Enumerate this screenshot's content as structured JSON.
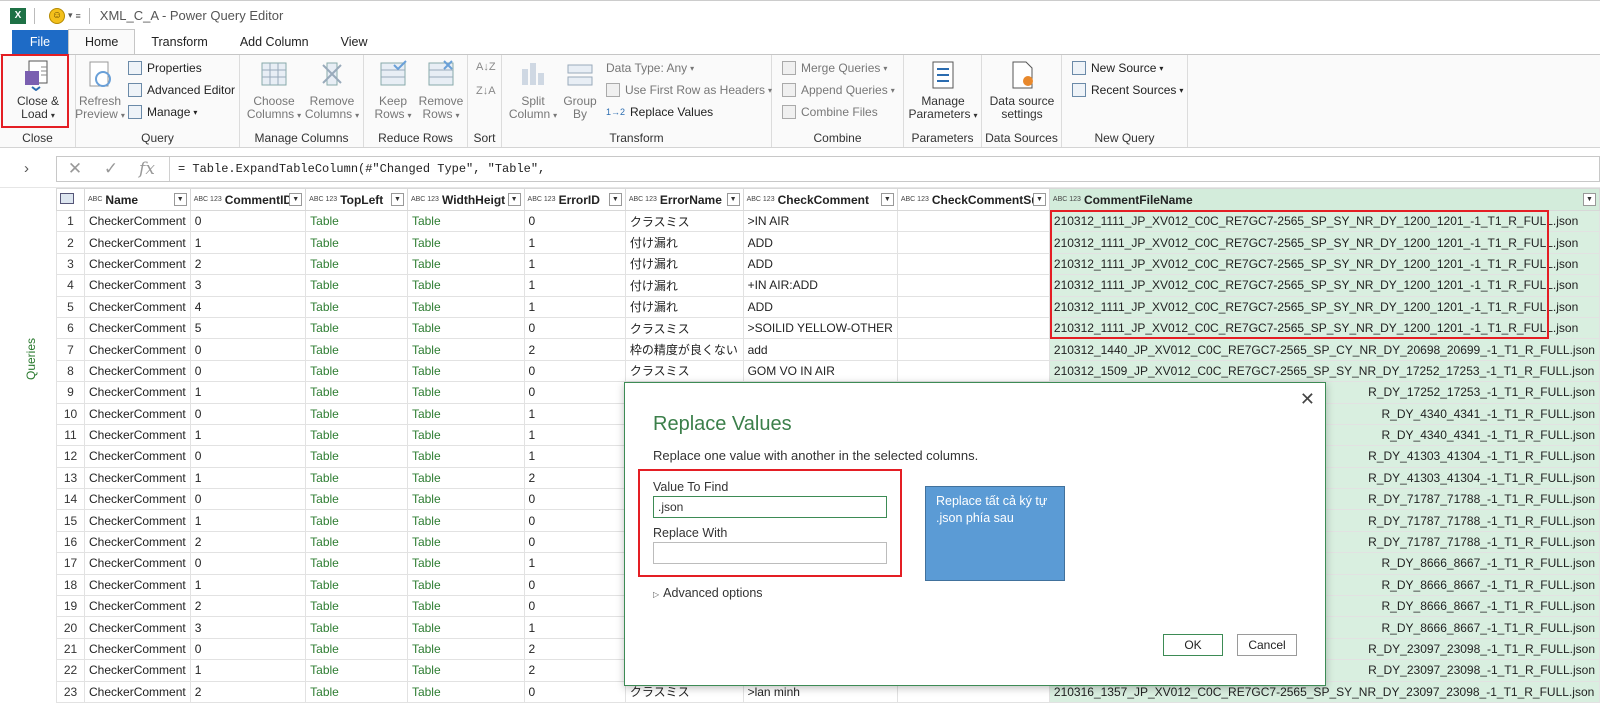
{
  "titlebar": {
    "app_icon": "X",
    "title": "XML_C_A - Power Query Editor"
  },
  "tabs": [
    "File",
    "Home",
    "Transform",
    "Add Column",
    "View"
  ],
  "ribbon": {
    "close": {
      "button": [
        "Close &",
        "Load"
      ],
      "label": "Close"
    },
    "query": {
      "refresh": [
        "Refresh",
        "Preview"
      ],
      "properties": "Properties",
      "advanced_editor": "Advanced Editor",
      "manage": "Manage",
      "label": "Query"
    },
    "manage_columns": {
      "choose": [
        "Choose",
        "Columns"
      ],
      "remove": [
        "Remove",
        "Columns"
      ],
      "label": "Manage Columns"
    },
    "reduce_rows": {
      "keep": [
        "Keep",
        "Rows"
      ],
      "remove": [
        "Remove",
        "Rows"
      ],
      "label": "Reduce Rows"
    },
    "sort": {
      "label": "Sort"
    },
    "transform": {
      "split": [
        "Split",
        "Column"
      ],
      "group": [
        "Group",
        "By"
      ],
      "data_type": "Data Type: Any",
      "first_row": "Use First Row as Headers",
      "replace": "Replace Values",
      "label": "Transform"
    },
    "combine": {
      "merge": "Merge Queries",
      "append": "Append Queries",
      "combine_files": "Combine Files",
      "label": "Combine"
    },
    "parameters": {
      "manage": [
        "Manage",
        "Parameters"
      ],
      "label": "Parameters"
    },
    "data_sources": {
      "settings": [
        "Data source",
        "settings"
      ],
      "label": "Data Sources"
    },
    "new_query": {
      "new_source": "New Source",
      "recent_sources": "Recent Sources",
      "label": "New Query"
    }
  },
  "formula": {
    "text": "= Table.ExpandTableColumn(#\"Changed Type\", \"Table\","
  },
  "queries_label": "Queries",
  "columns": [
    {
      "type": "ABC",
      "name": "Name"
    },
    {
      "type": "ABC 123",
      "name": "CommentID"
    },
    {
      "type": "ABC 123",
      "name": "TopLeft"
    },
    {
      "type": "ABC 123",
      "name": "WidthHeigt"
    },
    {
      "type": "ABC 123",
      "name": "ErrorID"
    },
    {
      "type": "ABC 123",
      "name": "ErrorName"
    },
    {
      "type": "ABC 123",
      "name": "CheckComment"
    },
    {
      "type": "ABC 123",
      "name": "CheckCommentSub"
    },
    {
      "type": "ABC 123",
      "name": "CommentFileName"
    }
  ],
  "rows": [
    [
      "1",
      "CheckerComment",
      "0",
      "Table",
      "Table",
      "0",
      "クラスミス",
      ">IN AIR",
      "",
      "210312_1111_JP_XV012_C0C_RE7GC7-2565_SP_SY_NR_DY_1200_1201_-1_T1_R_FULL.json"
    ],
    [
      "2",
      "CheckerComment",
      "1",
      "Table",
      "Table",
      "1",
      "付け漏れ",
      "ADD",
      "",
      "210312_1111_JP_XV012_C0C_RE7GC7-2565_SP_SY_NR_DY_1200_1201_-1_T1_R_FULL.json"
    ],
    [
      "3",
      "CheckerComment",
      "2",
      "Table",
      "Table",
      "1",
      "付け漏れ",
      "ADD",
      "",
      "210312_1111_JP_XV012_C0C_RE7GC7-2565_SP_SY_NR_DY_1200_1201_-1_T1_R_FULL.json"
    ],
    [
      "4",
      "CheckerComment",
      "3",
      "Table",
      "Table",
      "1",
      "付け漏れ",
      "+IN AIR:ADD",
      "",
      "210312_1111_JP_XV012_C0C_RE7GC7-2565_SP_SY_NR_DY_1200_1201_-1_T1_R_FULL.json"
    ],
    [
      "5",
      "CheckerComment",
      "4",
      "Table",
      "Table",
      "1",
      "付け漏れ",
      "ADD",
      "",
      "210312_1111_JP_XV012_C0C_RE7GC7-2565_SP_SY_NR_DY_1200_1201_-1_T1_R_FULL.json"
    ],
    [
      "6",
      "CheckerComment",
      "5",
      "Table",
      "Table",
      "0",
      "クラスミス",
      ">SOILID YELLOW-OTHER",
      "",
      "210312_1111_JP_XV012_C0C_RE7GC7-2565_SP_SY_NR_DY_1200_1201_-1_T1_R_FULL.json"
    ],
    [
      "7",
      "CheckerComment",
      "0",
      "Table",
      "Table",
      "2",
      "枠の精度が良くない",
      "add",
      "",
      "210312_1440_JP_XV012_C0C_RE7GC7-2565_SP_CY_NR_DY_20698_20699_-1_T1_R_FULL.json"
    ],
    [
      "8",
      "CheckerComment",
      "0",
      "Table",
      "Table",
      "0",
      "クラスミス",
      "GOM VO IN AIR",
      "",
      "210312_1509_JP_XV012_C0C_RE7GC7-2565_SP_SY_NR_DY_17252_17253_-1_T1_R_FULL.json"
    ],
    [
      "9",
      "CheckerComment",
      "1",
      "Table",
      "Table",
      "0",
      "",
      "",
      "",
      "R_DY_17252_17253_-1_T1_R_FULL.json"
    ],
    [
      "10",
      "CheckerComment",
      "0",
      "Table",
      "Table",
      "1",
      "",
      "",
      "",
      "R_DY_4340_4341_-1_T1_R_FULL.json"
    ],
    [
      "11",
      "CheckerComment",
      "1",
      "Table",
      "Table",
      "1",
      "",
      "",
      "",
      "R_DY_4340_4341_-1_T1_R_FULL.json"
    ],
    [
      "12",
      "CheckerComment",
      "0",
      "Table",
      "Table",
      "1",
      "",
      "",
      "",
      "R_DY_41303_41304_-1_T1_R_FULL.json"
    ],
    [
      "13",
      "CheckerComment",
      "1",
      "Table",
      "Table",
      "2",
      "",
      "",
      "",
      "R_DY_41303_41304_-1_T1_R_FULL.json"
    ],
    [
      "14",
      "CheckerComment",
      "0",
      "Table",
      "Table",
      "0",
      "",
      "",
      "",
      "R_DY_71787_71788_-1_T1_R_FULL.json"
    ],
    [
      "15",
      "CheckerComment",
      "1",
      "Table",
      "Table",
      "0",
      "",
      "",
      "",
      "R_DY_71787_71788_-1_T1_R_FULL.json"
    ],
    [
      "16",
      "CheckerComment",
      "2",
      "Table",
      "Table",
      "0",
      "",
      "",
      "",
      "R_DY_71787_71788_-1_T1_R_FULL.json"
    ],
    [
      "17",
      "CheckerComment",
      "0",
      "Table",
      "Table",
      "1",
      "",
      "",
      "",
      "R_DY_8666_8667_-1_T1_R_FULL.json"
    ],
    [
      "18",
      "CheckerComment",
      "1",
      "Table",
      "Table",
      "0",
      "",
      "",
      "",
      "R_DY_8666_8667_-1_T1_R_FULL.json"
    ],
    [
      "19",
      "CheckerComment",
      "2",
      "Table",
      "Table",
      "0",
      "",
      "",
      "",
      "R_DY_8666_8667_-1_T1_R_FULL.json"
    ],
    [
      "20",
      "CheckerComment",
      "3",
      "Table",
      "Table",
      "1",
      "",
      "",
      "",
      "R_DY_8666_8667_-1_T1_R_FULL.json"
    ],
    [
      "21",
      "CheckerComment",
      "0",
      "Table",
      "Table",
      "2",
      "",
      "",
      "",
      "R_DY_23097_23098_-1_T1_R_FULL.json"
    ],
    [
      "22",
      "CheckerComment",
      "1",
      "Table",
      "Table",
      "2",
      "",
      "",
      "",
      "R_DY_23097_23098_-1_T1_R_FULL.json"
    ],
    [
      "23",
      "CheckerComment",
      "2",
      "Table",
      "Table",
      "0",
      "クラスミス",
      ">lan minh",
      "",
      "210316_1357_JP_XV012_C0C_RE7GC7-2565_SP_SY_NR_DY_23097_23098_-1_T1_R_FULL.json"
    ]
  ],
  "dialog": {
    "title": "Replace Values",
    "description": "Replace one value with another in the selected columns.",
    "find_label": "Value To Find",
    "find_value": ".json",
    "replace_label": "Replace With",
    "replace_value": "",
    "note": "Replace tất cả ký tự .json phía sau",
    "advanced": "Advanced options",
    "ok": "OK",
    "cancel": "Cancel"
  },
  "colors": {
    "accent_green": "#3b7f4a",
    "highlight_red": "#e41e24",
    "file_tab": "#1e6bc6",
    "note_blue": "#5b9bd5",
    "selected_col": "#d9efe0"
  }
}
